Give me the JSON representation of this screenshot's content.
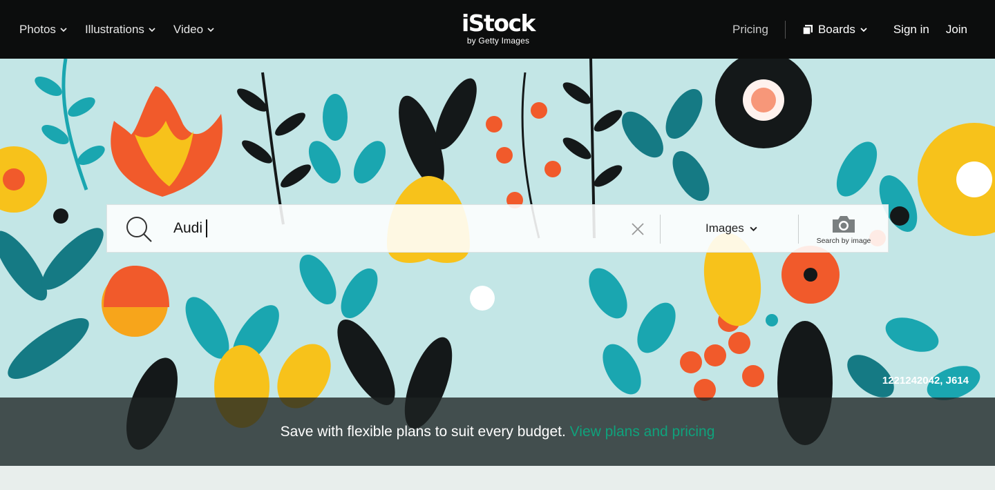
{
  "header": {
    "nav": [
      {
        "label": "Photos"
      },
      {
        "label": "Illustrations"
      },
      {
        "label": "Video"
      }
    ],
    "logo": {
      "main": "iStock",
      "sub": "by Getty Images"
    },
    "pricing_label": "Pricing",
    "boards_label": "Boards",
    "signin_label": "Sign in",
    "join_label": "Join"
  },
  "search": {
    "value": "Audi",
    "type_label": "Images",
    "by_image_label": "Search by image"
  },
  "hero": {
    "credit": "1221242042, J614"
  },
  "banner": {
    "text": "Save with flexible plans to suit every budget.",
    "link": "View plans and pricing"
  },
  "colors": {
    "header_bg": "#0c0d0d",
    "hero_bg": "#c3e6e6",
    "accent_link": "#0fa27c",
    "orange": "#f15a2b",
    "yellow": "#f7c21b",
    "teal": "#1aa6b0",
    "dark": "#141819"
  },
  "icons": [
    "chevron-down-icon",
    "boards-icon",
    "search-icon",
    "close-icon",
    "camera-icon"
  ]
}
